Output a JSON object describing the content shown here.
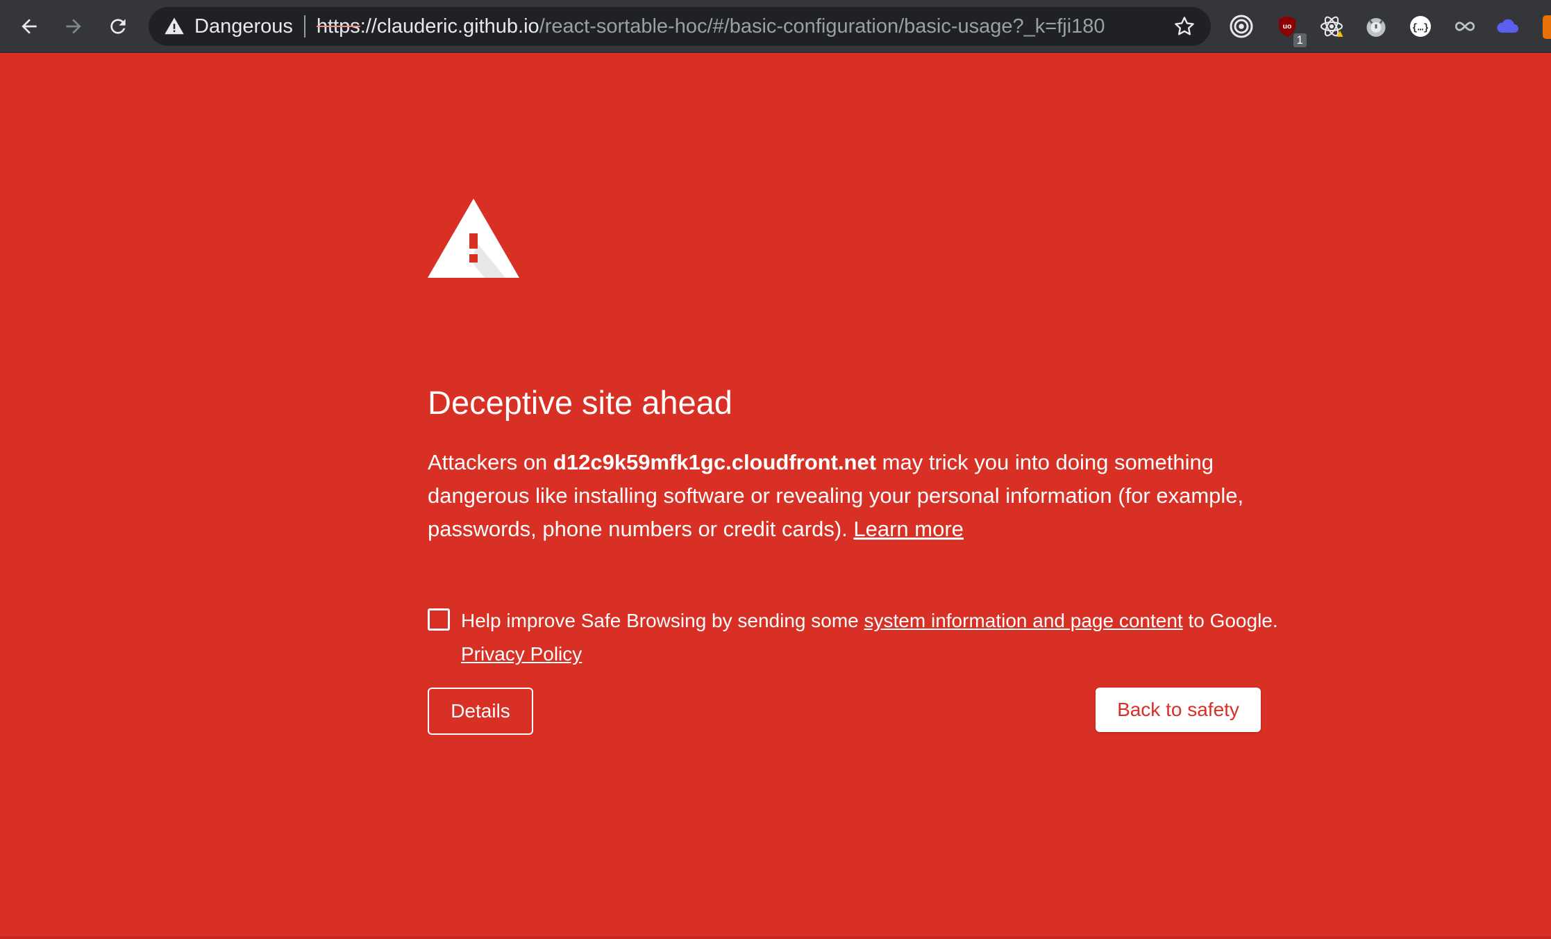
{
  "colors": {
    "background": "#d93025",
    "toolbar": "#35363a",
    "omnibox": "#202124",
    "text": "#ffffff"
  },
  "browser": {
    "security_state": "Dangerous",
    "url": {
      "scheme": "https",
      "host": "://clauderic.github.io",
      "path": "/react-sortable-hoc/#/basic-configuration/basic-usage?_k=fji180"
    },
    "extensions": [
      {
        "icon": "target-icon"
      },
      {
        "icon": "ublock-icon",
        "badge": "1"
      },
      {
        "icon": "react-devtools-icon"
      },
      {
        "icon": "owl-icon"
      },
      {
        "icon": "json-viewer-icon"
      },
      {
        "icon": "infinity-icon"
      },
      {
        "icon": "cloud-icon"
      }
    ]
  },
  "interstitial": {
    "heading": "Deceptive site ahead",
    "message": {
      "prefix": "Attackers on ",
      "domain": "d12c9k59mfk1gc.cloudfront.net",
      "suffix": " may trick you into doing something dangerous like installing software or revealing your personal information (for example, passwords, phone numbers or credit cards). ",
      "learn_more": "Learn more"
    },
    "opt_in": {
      "checked": false,
      "prefix": "Help improve Safe Browsing by sending some ",
      "link": "system information and page content",
      "suffix": " to Google. ",
      "privacy_link": "Privacy Policy"
    },
    "details_label": "Details",
    "back_to_safety_label": "Back to safety"
  }
}
